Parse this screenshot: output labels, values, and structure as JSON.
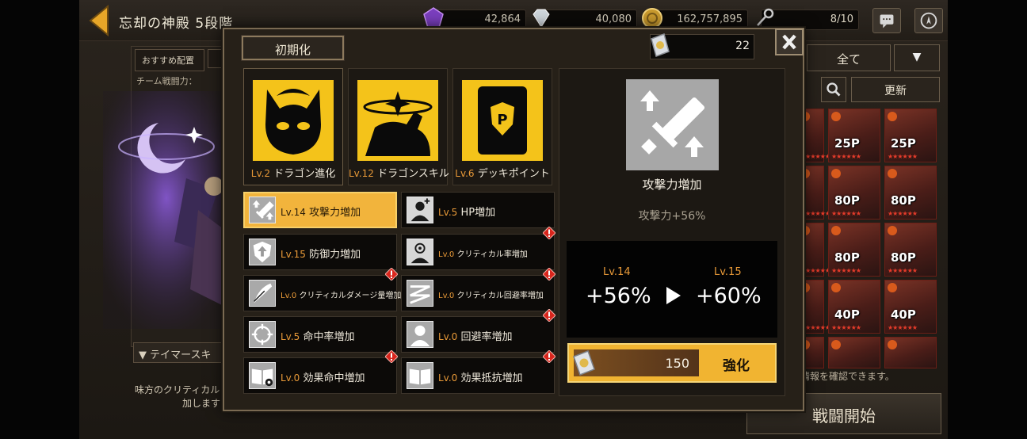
{
  "topbar": {
    "title": "忘却の神殿 5段階",
    "resources": [
      "42,864",
      "40,080",
      "162,757,895",
      "8/10"
    ]
  },
  "background": {
    "recommend_label": "おすすめ配置",
    "team_power_label": "チーム戦闘力：",
    "tamer_skill_label": "テイマースキ",
    "skill_desc_line1": "味方のクリティカル",
    "skill_desc_line2": "加します",
    "filter_all": "全て",
    "update_label": "更新",
    "info_text": "情報を確認できます。",
    "battle_start": "戦闘開始",
    "cards": [
      {
        "pts": ""
      },
      {
        "pts": "25P"
      },
      {
        "pts": "25P"
      },
      {
        "pts": ""
      },
      {
        "pts": "80P"
      },
      {
        "pts": "80P"
      },
      {
        "pts": ""
      },
      {
        "pts": "80P"
      },
      {
        "pts": "80P"
      },
      {
        "pts": ""
      },
      {
        "pts": "40P"
      },
      {
        "pts": "40P"
      },
      {
        "pts": ""
      },
      {
        "pts": ""
      },
      {
        "pts": ""
      }
    ]
  },
  "modal": {
    "reset_label": "初期化",
    "currency_amount": "22",
    "categories": [
      {
        "level": "Lv.2",
        "name": "ドラゴン進化",
        "icon": "dragon-mask-icon"
      },
      {
        "level": "Lv.12",
        "name": "ドラゴンスキル",
        "icon": "dragon-skill-icon"
      },
      {
        "level": "Lv.6",
        "name": "デッキポイント",
        "icon": "deck-point-card-icon"
      }
    ],
    "skills": [
      {
        "level": "Lv.14",
        "name": "攻撃力増加",
        "icon": "sword-up-icon",
        "selected": true,
        "alert": false
      },
      {
        "level": "Lv.5",
        "name": "HP増加",
        "icon": "person-hp-icon",
        "selected": false,
        "alert": false
      },
      {
        "level": "Lv.15",
        "name": "防御力増加",
        "icon": "shield-up-icon",
        "selected": false,
        "alert": false
      },
      {
        "level": "Lv.0",
        "name": "クリティカル率増加",
        "icon": "critical-target-icon",
        "selected": false,
        "alert": true
      },
      {
        "level": "Lv.0",
        "name": "クリティカルダメージ量増加",
        "icon": "critical-slash-icon",
        "selected": false,
        "alert": true
      },
      {
        "level": "Lv.0",
        "name": "クリティカル回避率増加",
        "icon": "critical-evade-icon",
        "selected": false,
        "alert": true
      },
      {
        "level": "Lv.5",
        "name": "命中率増加",
        "icon": "crosshair-icon",
        "selected": false,
        "alert": false
      },
      {
        "level": "Lv.0",
        "name": "回避率増加",
        "icon": "evade-person-icon",
        "selected": false,
        "alert": true
      },
      {
        "level": "Lv.0",
        "name": "効果命中増加",
        "icon": "book-hit-icon",
        "selected": false,
        "alert": true
      },
      {
        "level": "Lv.0",
        "name": "効果抵抗増加",
        "icon": "book-resist-icon",
        "selected": false,
        "alert": true
      }
    ],
    "detail": {
      "title": "攻撃力増加",
      "effect": "攻撃力+56%",
      "current_level": "Lv.14",
      "current_value": "+56%",
      "next_level": "Lv.15",
      "next_value": "+60%",
      "cost": "150",
      "upgrade_label": "強化"
    }
  },
  "colors": {
    "accent_gold": "#f2b43c",
    "category_yellow": "#f4c31a",
    "level_orange": "#e99a38",
    "alert_red": "#d9251c"
  }
}
